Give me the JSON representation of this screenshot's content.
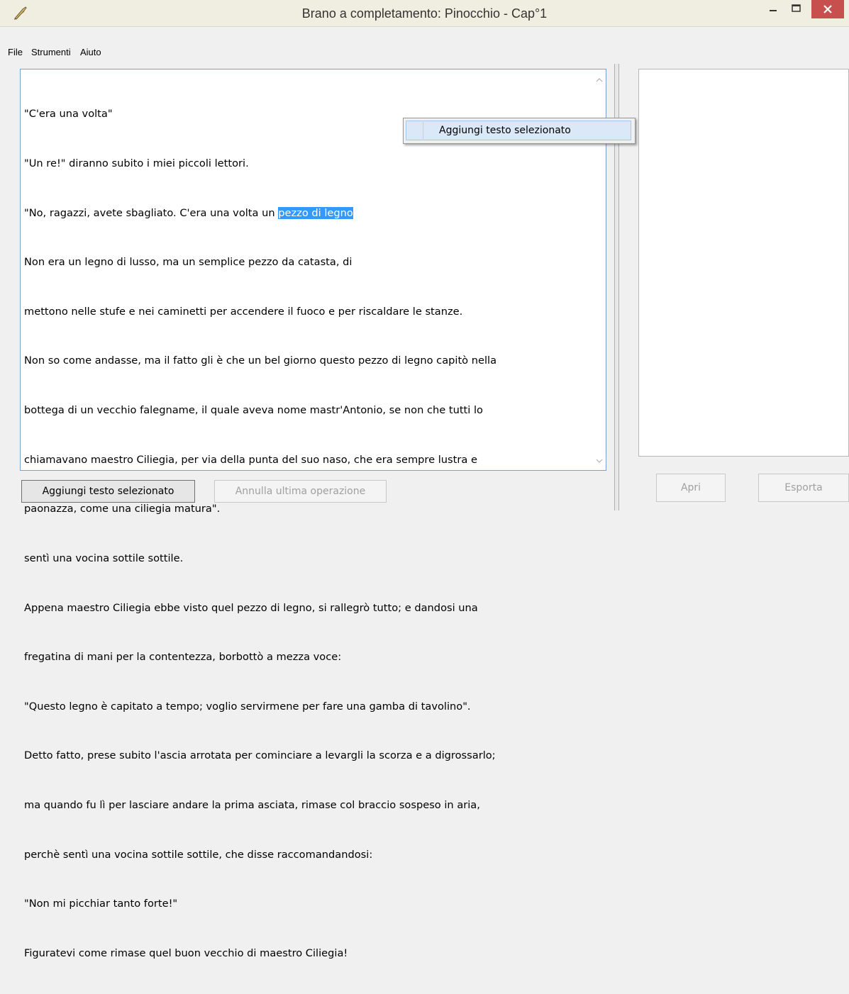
{
  "window": {
    "title": "Brano a completamento: Pinocchio - Cap°1",
    "icon": "quill-pen-icon",
    "close_color": "#c7504e"
  },
  "menu": {
    "items": [
      "File",
      "Strumenti",
      "Aiuto"
    ]
  },
  "editor": {
    "lines": [
      "\"C'era una volta\"",
      "\"Un re!\" diranno subito i miei piccoli lettori.",
      "\"No, ragazzi, avete sbagliato. C'era una volta un ",
      "Non era un legno di lusso, ma un semplice pezzo da catasta, di",
      "mettono nelle stufe e nei caminetti per accendere il fuoco e per riscaldare le stanze.",
      "Non so come andasse, ma il fatto gli è che un bel giorno questo pezzo di legno capitò nella",
      "bottega di un vecchio falegname, il quale aveva nome mastr'Antonio, se non che tutti lo",
      "chiamavano maestro Ciliegia, per via della punta del suo naso, che era sempre lustra e",
      "paonazza, come una ciliegia matura\".",
      "sentì una vocina sottile sottile.",
      "Appena maestro Ciliegia ebbe visto quel pezzo di legno, si rallegrò tutto; e dandosi una",
      "fregatina di mani per la contentezza, borbottò a mezza voce:",
      "\"Questo legno è capitato a tempo; voglio servirmene per fare una gamba di tavolino\".",
      "Detto fatto, prese subito l'ascia arrotata per cominciare a levargli la scorza e a digrossarlo;",
      "ma quando fu lì per lasciare andare la prima asciata, rimase col braccio sospeso in aria,",
      "perchè sentì una vocina sottile sottile, che disse raccomandandosi:",
      "\"Non mi picchiar tanto forte!\"",
      "Figuratevi come rimase quel buon vecchio di maestro Ciliegia!"
    ],
    "selected_text": "pezzo di legno",
    "selection_color": "#3399ff"
  },
  "context_menu": {
    "item_label": "Aggiungi testo selezionato"
  },
  "buttons": {
    "add_selected": "Aggiungi testo selezionato",
    "undo_last": "Annulla ultima operazione",
    "open": "Apri",
    "export": "Esporta"
  }
}
